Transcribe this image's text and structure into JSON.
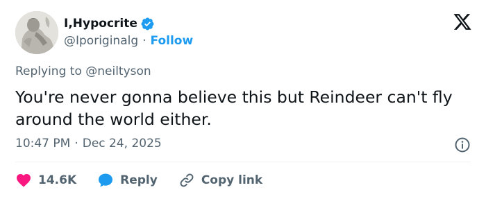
{
  "author": {
    "display_name": "I,Hypocrite",
    "handle": "@Iporiginalg",
    "separator": "·",
    "follow_label": "Follow",
    "verified": true,
    "verified_color": "#1d9bf0"
  },
  "replying": {
    "prefix": "Replying to",
    "mention": "@neiltyson"
  },
  "tweet": {
    "text": "You're never gonna believe this but Reindeer can't fly around the world either.",
    "time": "10:47 PM",
    "separator": "·",
    "date": "Dec 24, 2025"
  },
  "actions": {
    "like_count": "14.6K",
    "like_icon": "heart-icon",
    "like_color": "#f91880",
    "reply_label": "Reply",
    "reply_icon": "speech-bubble-icon",
    "reply_color": "#1d9bf0",
    "copy_label": "Copy link",
    "copy_icon": "link-icon"
  },
  "icons": {
    "platform": "x-logo-icon",
    "info": "info-icon"
  }
}
